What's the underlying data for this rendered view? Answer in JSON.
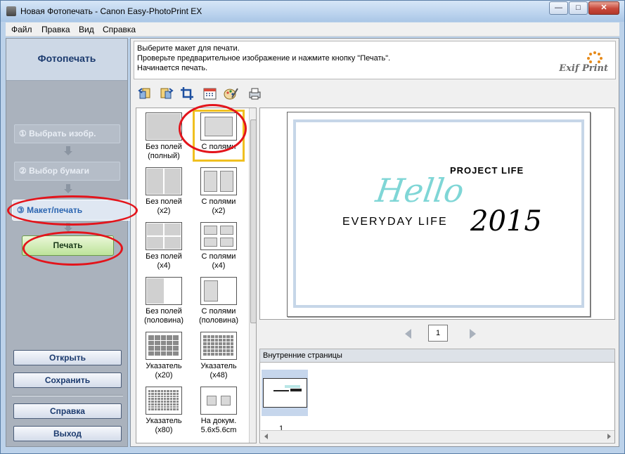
{
  "window": {
    "title": "Новая Фотопечать - Canon Easy-PhotoPrint EX",
    "min": "—",
    "max": "□",
    "close": "✕"
  },
  "menu": [
    "Файл",
    "Правка",
    "Вид",
    "Справка"
  ],
  "left": {
    "title": "Фотопечать",
    "steps": [
      "① Выбрать изобр.",
      "② Выбор бумаги",
      "③ Макет/печать"
    ],
    "print": "Печать",
    "buttons": [
      "Открыть",
      "Сохранить",
      "Справка",
      "Выход"
    ]
  },
  "instructions": [
    "Выберите макет для печати.",
    "Проверьте предварительное изображение и нажмите кнопку \"Печать\".",
    "Начинается печать."
  ],
  "logo": "Exif Print",
  "toolbar": [
    "rotate-left-icon",
    "rotate-right-icon",
    "crop-icon",
    "date-icon",
    "edit-palette-icon",
    "print-settings-icon"
  ],
  "layouts": [
    {
      "line1": "Без полей",
      "line2": "(полный)"
    },
    {
      "line1": "С полями",
      "line2": ""
    },
    {
      "line1": "Без полей",
      "line2": "(x2)"
    },
    {
      "line1": "С полями",
      "line2": "(x2)"
    },
    {
      "line1": "Без полей",
      "line2": "(x4)"
    },
    {
      "line1": "С полями",
      "line2": "(x4)"
    },
    {
      "line1": "Без полей",
      "line2": "(половина)"
    },
    {
      "line1": "С полями",
      "line2": "(половина)"
    },
    {
      "line1": "Указатель",
      "line2": "(x20)"
    },
    {
      "line1": "Указатель",
      "line2": "(x48)"
    },
    {
      "line1": "Указатель",
      "line2": "(x80)"
    },
    {
      "line1": "На докум.",
      "line2": "5.6x5.6cm"
    }
  ],
  "preview": {
    "project": "PROJECT LIFE",
    "hello": "Hello",
    "everyday": "EVERYDAY  LIFE",
    "year": "2015"
  },
  "page_number": "1",
  "inner_pages": {
    "title": "Внутренние страницы",
    "page_label": "1"
  }
}
